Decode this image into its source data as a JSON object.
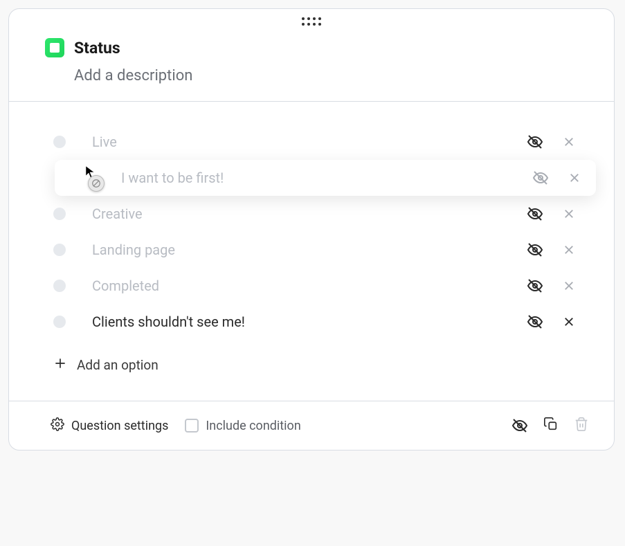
{
  "header": {
    "title": "Status",
    "description_placeholder": "Add a description"
  },
  "options": [
    {
      "label": "Live",
      "muted": true
    },
    {
      "label": "I want to be first!",
      "muted": true,
      "dragging": true
    },
    {
      "label": "Creative",
      "muted": true
    },
    {
      "label": "Landing page",
      "muted": true
    },
    {
      "label": "Completed",
      "muted": true
    },
    {
      "label": "Clients shouldn't see me!",
      "muted": false
    }
  ],
  "add_option_label": "Add an option",
  "footer": {
    "settings_label": "Question settings",
    "include_condition_label": "Include condition"
  }
}
